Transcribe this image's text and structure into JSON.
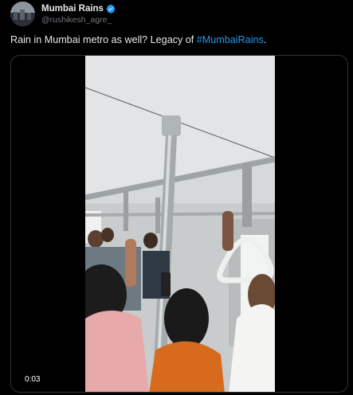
{
  "account": {
    "display_name": "Mumbai Rains",
    "handle": "@rushikesh_agre_",
    "verified_icon": "verified-badge-icon",
    "avatar_icon": "city-skyline-avatar"
  },
  "tweet": {
    "text_before": "Rain in Mumbai metro as well? Legacy of ",
    "hashtag": "#MumbaiRains",
    "text_after": "."
  },
  "media": {
    "type": "video",
    "timestamp": "0:03"
  },
  "colors": {
    "background": "#000000",
    "text": "#e7e9ea",
    "muted": "#71767b",
    "accent": "#1d9bf0",
    "border": "#2f3336"
  }
}
